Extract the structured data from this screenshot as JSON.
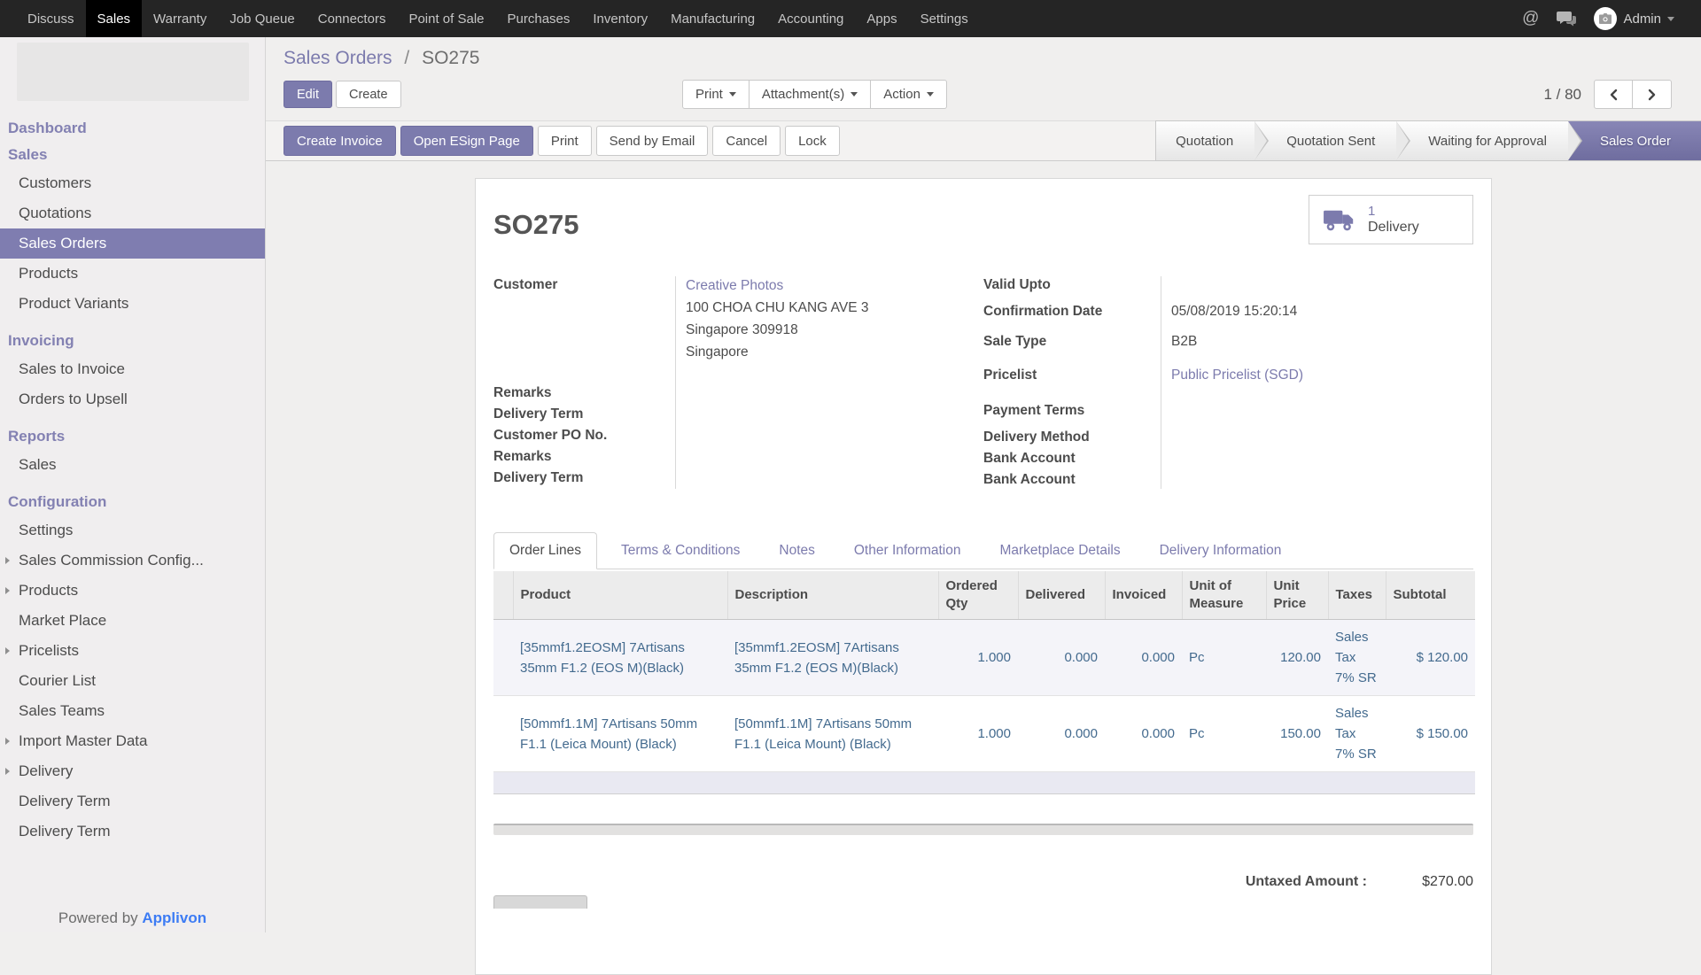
{
  "topbar": {
    "menus": [
      "Discuss",
      "Sales",
      "Warranty",
      "Job Queue",
      "Connectors",
      "Point of Sale",
      "Purchases",
      "Inventory",
      "Manufacturing",
      "Accounting",
      "Apps",
      "Settings"
    ],
    "active_menu": "Sales",
    "user_name": "Admin"
  },
  "breadcrumb": {
    "parent": "Sales Orders",
    "separator": "/",
    "current": "SO275"
  },
  "controls": {
    "edit": "Edit",
    "create": "Create",
    "print": "Print",
    "attachments": "Attachment(s)",
    "action": "Action",
    "pager": "1 / 80"
  },
  "statusbar": {
    "buttons": [
      {
        "label": "Create Invoice"
      },
      {
        "label": "Open ESign Page"
      },
      {
        "label": "Print"
      },
      {
        "label": "Send by Email"
      },
      {
        "label": "Cancel"
      },
      {
        "label": "Lock"
      }
    ],
    "stages": [
      "Quotation",
      "Quotation Sent",
      "Waiting for Approval",
      "Sales Order"
    ],
    "active_stage": "Sales Order"
  },
  "sidebar": {
    "sections": [
      {
        "header": "Dashboard",
        "items": []
      },
      {
        "header": "Sales",
        "items": [
          {
            "label": "Customers"
          },
          {
            "label": "Quotations"
          },
          {
            "label": "Sales Orders"
          },
          {
            "label": "Products"
          },
          {
            "label": "Product Variants"
          }
        ]
      },
      {
        "header": "Invoicing",
        "items": [
          {
            "label": "Sales to Invoice"
          },
          {
            "label": "Orders to Upsell"
          }
        ]
      },
      {
        "header": "Reports",
        "items": [
          {
            "label": "Sales"
          }
        ]
      },
      {
        "header": "Configuration",
        "items": [
          {
            "label": "Settings"
          },
          {
            "label": "Sales Commission Config..."
          },
          {
            "label": "Products"
          },
          {
            "label": "Market Place"
          },
          {
            "label": "Pricelists"
          },
          {
            "label": "Courier List"
          },
          {
            "label": "Sales Teams"
          },
          {
            "label": "Import Master Data"
          },
          {
            "label": "Delivery"
          },
          {
            "label": "Delivery Term"
          },
          {
            "label": "Delivery Term"
          }
        ]
      }
    ],
    "active_item": "Sales Orders",
    "powered_by": "Powered by",
    "brand": "Applivon"
  },
  "sheet": {
    "title": "SO275",
    "smart_button": {
      "count": "1",
      "label": "Delivery"
    },
    "customer": {
      "label": "Customer",
      "name": "Creative Photos",
      "address": [
        "100 CHOA CHU KANG AVE 3",
        "Singapore 309918",
        "Singapore"
      ]
    },
    "left_fields": [
      "Remarks",
      "Delivery Term",
      "Customer PO No.",
      "Remarks",
      "Delivery Term"
    ],
    "right_fields": [
      {
        "label": "Valid Upto",
        "value": ""
      },
      {
        "label": "Confirmation Date",
        "value": "05/08/2019 15:20:14"
      },
      {
        "label": "Sale Type",
        "value": "B2B"
      },
      {
        "label": "Pricelist",
        "value": "Public Pricelist (SGD)"
      },
      {
        "label": "Payment Terms",
        "value": ""
      },
      {
        "label": "Delivery Method",
        "value": ""
      },
      {
        "label": "Bank Account",
        "value": ""
      },
      {
        "label": "Bank Account",
        "value": ""
      }
    ],
    "tabs": [
      "Order Lines",
      "Terms & Conditions",
      "Notes",
      "Other Information",
      "Marketplace Details",
      "Delivery Information"
    ],
    "active_tab": "Order Lines",
    "table": {
      "headers": [
        "Product",
        "Description",
        "Ordered Qty",
        "Delivered",
        "Invoiced",
        "Unit of Measure",
        "Unit Price",
        "Taxes",
        "Subtotal"
      ],
      "rows": [
        {
          "product": "[35mmf1.2EOSM] 7Artisans 35mm F1.2 (EOS M)(Black)",
          "description": "[35mmf1.2EOSM] 7Artisans 35mm F1.2 (EOS M)(Black)",
          "ordered_qty": "1.000",
          "delivered": "0.000",
          "invoiced": "0.000",
          "uom": "Pc",
          "unit_price": "120.00",
          "taxes": "Sales Tax 7% SR",
          "subtotal": "$ 120.00"
        },
        {
          "product": "[50mmf1.1M] 7Artisans 50mm F1.1 (Leica Mount) (Black)",
          "description": "[50mmf1.1M] 7Artisans 50mm F1.1 (Leica Mount) (Black)",
          "ordered_qty": "1.000",
          "delivered": "0.000",
          "invoiced": "0.000",
          "uom": "Pc",
          "unit_price": "150.00",
          "taxes": "Sales Tax 7% SR",
          "subtotal": "$ 150.00"
        }
      ]
    },
    "totals": {
      "label": "Untaxed Amount :",
      "value": "$270.00"
    }
  },
  "colors": {
    "accent": "#7c7bad",
    "topbar_bg": "#252525",
    "table_text": "#436a8e",
    "brand_blue": "#3d7cf4",
    "page_bg": "#f0efee"
  }
}
